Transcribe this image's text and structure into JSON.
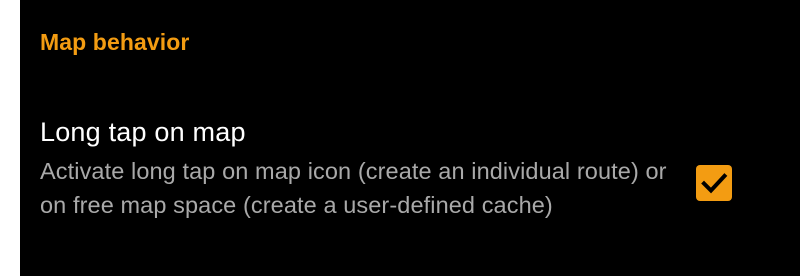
{
  "colors": {
    "accent": "#f39c12",
    "background": "#000000",
    "title_text": "#ffffff",
    "summary_text": "#a9a9a9",
    "checkmark": "#000000"
  },
  "section": {
    "header": "Map behavior"
  },
  "preference": {
    "title": "Long tap on map",
    "summary": "Activate long tap on map icon (create an individual route) or on free map space (create a user-defined cache)",
    "checked": true,
    "checkbox_icon": "checkbox-checked-icon"
  }
}
